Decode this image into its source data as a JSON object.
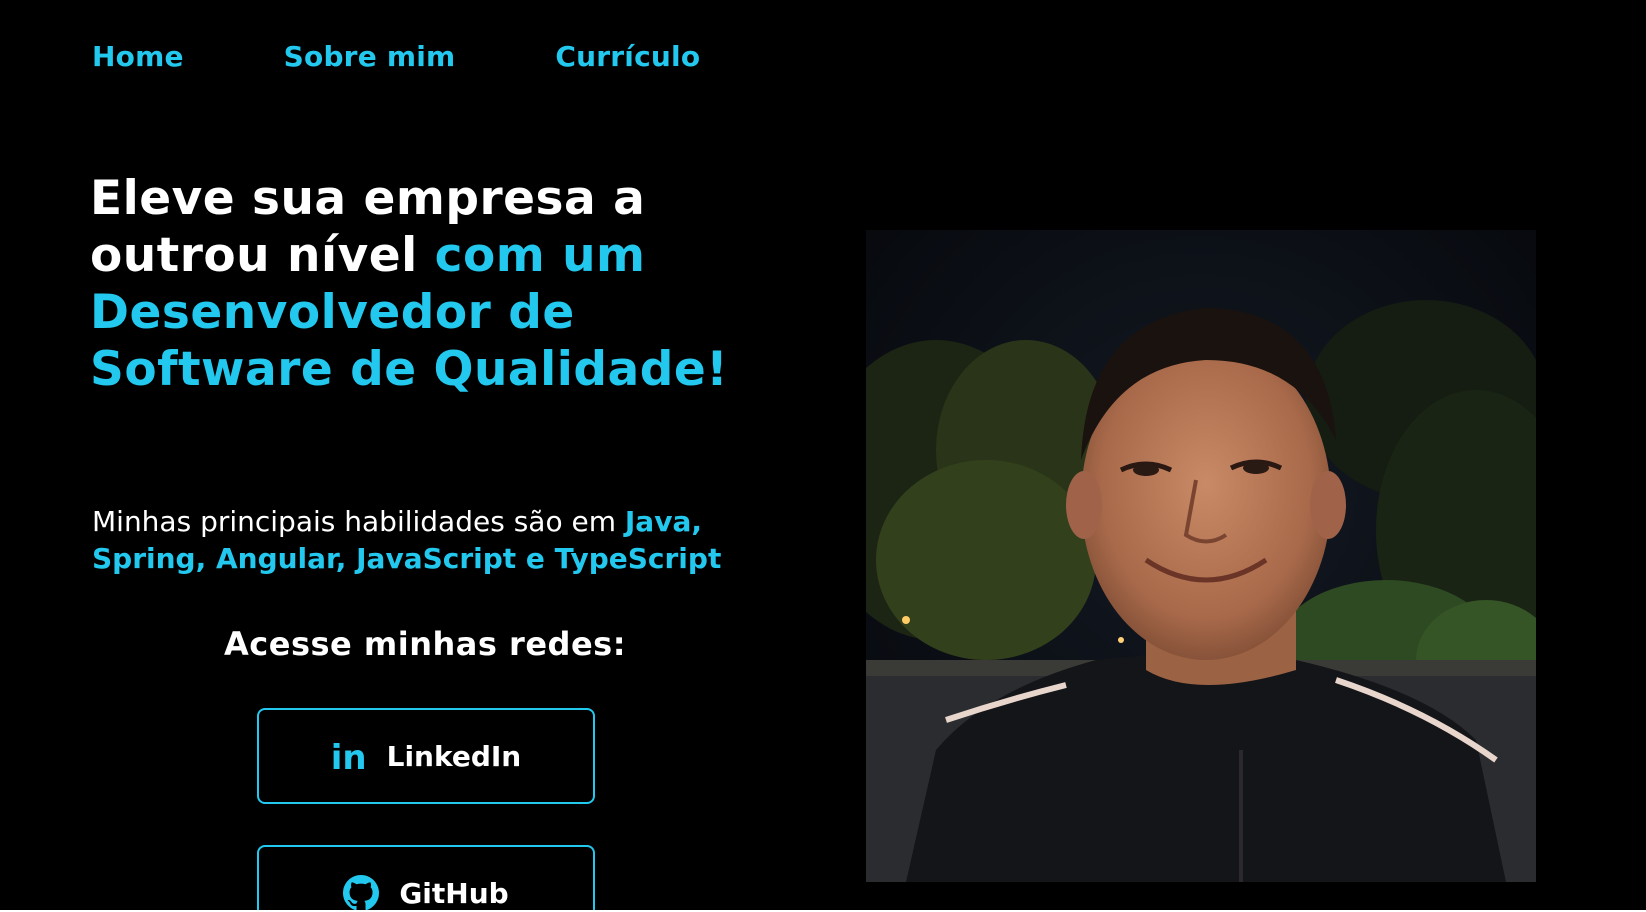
{
  "nav": {
    "home": "Home",
    "about": "Sobre mim",
    "resume": "Currículo"
  },
  "hero": {
    "headline_white": "Eleve sua empresa a outrou nível",
    "headline_accent": "com um Desenvolvedor de Software de Qualidade!",
    "skills_intro": "Minhas principais habilidades são em",
    "skills_list": "Java, Spring, Angular, JavaScript e TypeScript"
  },
  "social": {
    "title": "Acesse minhas redes:",
    "linkedin_label": "LinkedIn",
    "linkedin_icon": "in",
    "github_label": "GitHub"
  },
  "colors": {
    "accent": "#23c8ee",
    "background": "#000000",
    "text": "#ffffff"
  },
  "icons": {
    "linkedin": "linkedin-icon",
    "github": "github-icon"
  }
}
